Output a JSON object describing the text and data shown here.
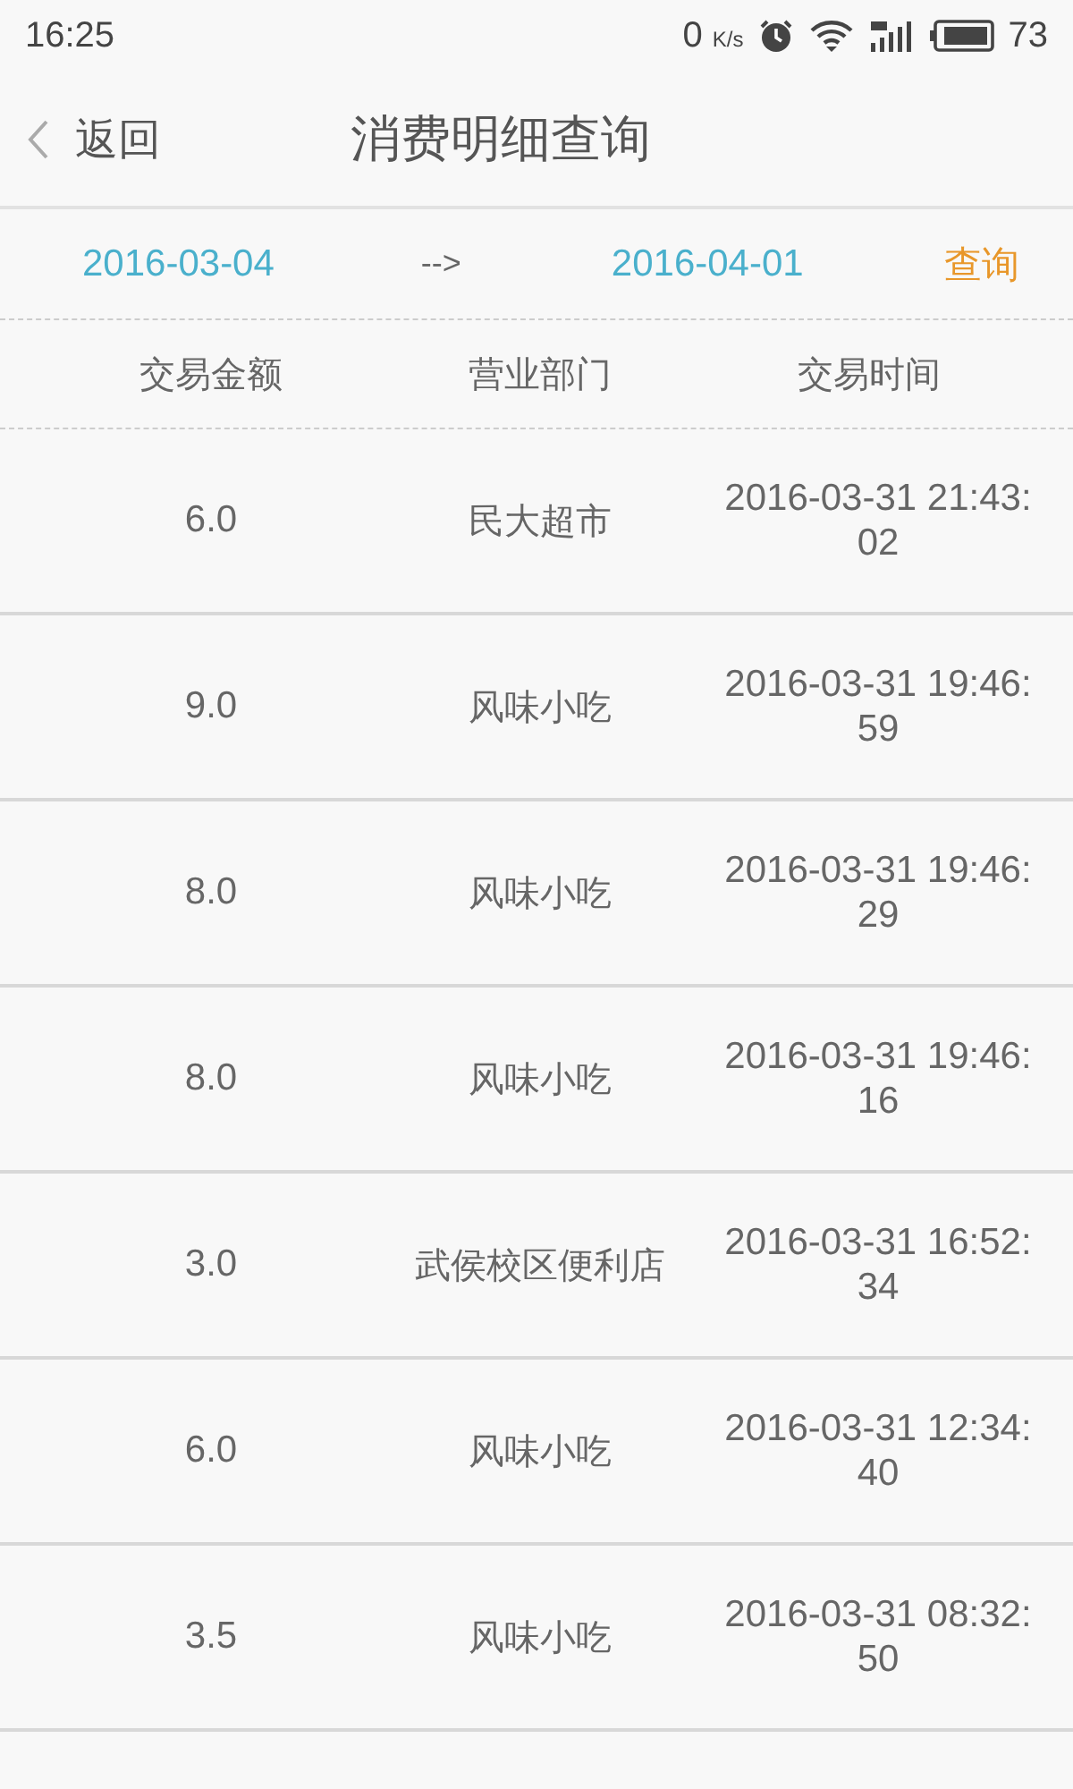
{
  "status_bar": {
    "time": "16:25",
    "speed": "0",
    "speed_unit": "K/s",
    "battery_text": "73"
  },
  "header": {
    "back_label": "返回",
    "title": "消费明细查询"
  },
  "query": {
    "start_date": "2016-03-04",
    "arrow": "-->",
    "end_date": "2016-04-01",
    "button": "查询"
  },
  "table": {
    "columns": [
      "交易金额",
      "营业部门",
      "交易时间"
    ],
    "rows": [
      {
        "amount": "6.0",
        "department": "民大超市",
        "time": "2016-03-31 21:43:02"
      },
      {
        "amount": "9.0",
        "department": "风味小吃",
        "time": "2016-03-31 19:46:59"
      },
      {
        "amount": "8.0",
        "department": "风味小吃",
        "time": "2016-03-31 19:46:29"
      },
      {
        "amount": "8.0",
        "department": "风味小吃",
        "time": "2016-03-31 19:46:16"
      },
      {
        "amount": "3.0",
        "department": "武侯校区便利店",
        "time": "2016-03-31 16:52:34"
      },
      {
        "amount": "6.0",
        "department": "风味小吃",
        "time": "2016-03-31 12:34:40"
      },
      {
        "amount": "3.5",
        "department": "风味小吃",
        "time": "2016-03-31 08:32:50"
      }
    ]
  }
}
